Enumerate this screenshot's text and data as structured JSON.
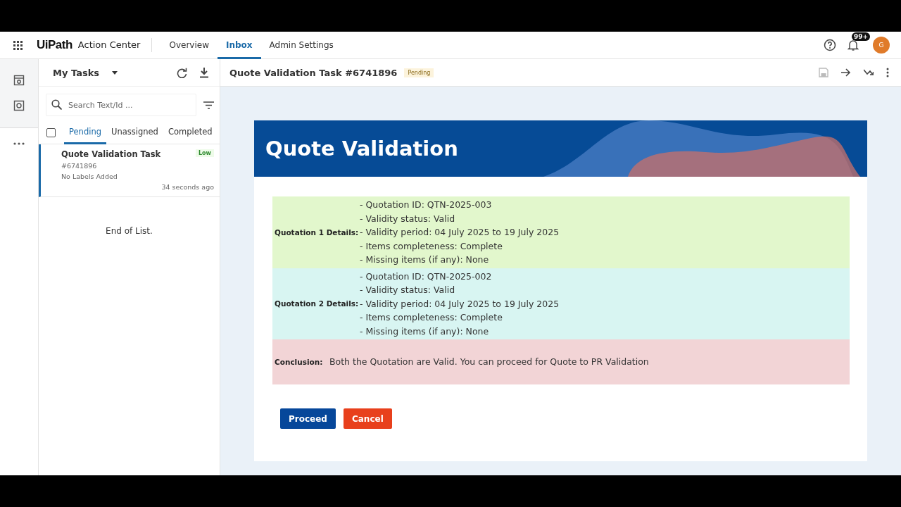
{
  "header": {
    "logo": "UiPath",
    "product": "Action Center",
    "nav": [
      {
        "label": "Overview",
        "selected": false
      },
      {
        "label": "Inbox",
        "selected": true
      },
      {
        "label": "Admin Settings",
        "selected": false
      }
    ],
    "notification_badge": "99+",
    "avatar": "G"
  },
  "task_list": {
    "title": "My Tasks",
    "search": {
      "placeholder": "Search Text/Id ..."
    },
    "select_all": {
      "checked": false
    },
    "tabs": [
      {
        "label": "Pending",
        "selected": true
      },
      {
        "label": "Unassigned",
        "selected": false
      },
      {
        "label": "Completed",
        "selected": false
      }
    ],
    "tasks": [
      {
        "title": "Quote Validation Task",
        "id": "#6741896",
        "priority": "Low",
        "labels": "No Labels Added",
        "time": "34 seconds ago",
        "selected": true
      }
    ],
    "end_text": "End of List."
  },
  "detail": {
    "title": "Quote Validation Task #6741896",
    "status": "Pending",
    "form": {
      "banner_title": "Quote Validation",
      "rows": [
        {
          "label": "Quotation 1 Details:",
          "color": "#e2f7cc",
          "lines": [
            "- Quotation ID: QTN-2025-003",
            "- Validity status: Valid",
            "- Validity period: 04 July 2025 to 19 July 2025",
            "- Items completeness: Complete",
            "- Missing items (if any): None"
          ]
        },
        {
          "label": "Quotation 2 Details:",
          "color": "#d8f5f2",
          "lines": [
            "- Quotation ID: QTN-2025-002",
            "- Validity status: Valid",
            "- Validity period: 04 July 2025 to 19 July 2025",
            "- Items completeness: Complete",
            "- Missing items (if any): None"
          ]
        },
        {
          "label": "Conclusion:",
          "color": "#f2d4d6",
          "lines": [
            "Both the Quotation are Valid. You can proceed for Quote to PR Validation"
          ]
        }
      ],
      "buttons": [
        {
          "label": "Proceed",
          "kind": "primary"
        },
        {
          "label": "Cancel",
          "kind": "danger"
        }
      ]
    }
  }
}
